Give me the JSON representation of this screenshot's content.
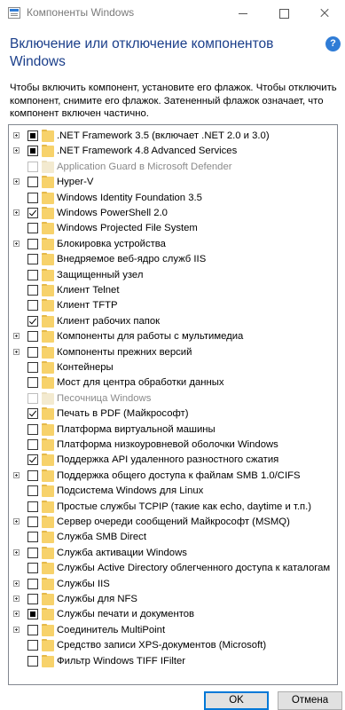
{
  "window": {
    "title": "Компоненты Windows"
  },
  "heading": "Включение или отключение компонентов Windows",
  "description": "Чтобы включить компонент, установите его флажок. Чтобы отключить компонент, снимите его флажок. Затененный флажок означает, что компонент включен частично.",
  "buttons": {
    "ok": "OK",
    "cancel": "Отмена"
  },
  "features": [
    {
      "label": ".NET Framework 3.5 (включает .NET 2.0 и 3.0)",
      "expandable": true,
      "state": "partial",
      "disabled": false
    },
    {
      "label": ".NET Framework 4.8 Advanced Services",
      "expandable": true,
      "state": "partial",
      "disabled": false
    },
    {
      "label": "Application Guard в Microsoft Defender",
      "expandable": false,
      "state": "unchecked",
      "disabled": true
    },
    {
      "label": "Hyper-V",
      "expandable": true,
      "state": "unchecked",
      "disabled": false
    },
    {
      "label": "Windows Identity Foundation 3.5",
      "expandable": false,
      "state": "unchecked",
      "disabled": false
    },
    {
      "label": "Windows PowerShell 2.0",
      "expandable": true,
      "state": "checked",
      "disabled": false
    },
    {
      "label": "Windows Projected File System",
      "expandable": false,
      "state": "unchecked",
      "disabled": false
    },
    {
      "label": "Блокировка устройства",
      "expandable": true,
      "state": "unchecked",
      "disabled": false
    },
    {
      "label": "Внедряемое веб-ядро служб IIS",
      "expandable": false,
      "state": "unchecked",
      "disabled": false
    },
    {
      "label": "Защищенный узел",
      "expandable": false,
      "state": "unchecked",
      "disabled": false
    },
    {
      "label": "Клиент Telnet",
      "expandable": false,
      "state": "unchecked",
      "disabled": false
    },
    {
      "label": "Клиент TFTP",
      "expandable": false,
      "state": "unchecked",
      "disabled": false
    },
    {
      "label": "Клиент рабочих папок",
      "expandable": false,
      "state": "checked",
      "disabled": false
    },
    {
      "label": "Компоненты для работы с мультимедиа",
      "expandable": true,
      "state": "unchecked",
      "disabled": false
    },
    {
      "label": "Компоненты прежних версий",
      "expandable": true,
      "state": "unchecked",
      "disabled": false
    },
    {
      "label": "Контейнеры",
      "expandable": false,
      "state": "unchecked",
      "disabled": false
    },
    {
      "label": "Мост для центра обработки данных",
      "expandable": false,
      "state": "unchecked",
      "disabled": false
    },
    {
      "label": "Песочница Windows",
      "expandable": false,
      "state": "unchecked",
      "disabled": true
    },
    {
      "label": "Печать в PDF (Майкрософт)",
      "expandable": false,
      "state": "checked",
      "disabled": false
    },
    {
      "label": "Платформа виртуальной машины",
      "expandable": false,
      "state": "unchecked",
      "disabled": false
    },
    {
      "label": "Платформа низкоуровневой оболочки Windows",
      "expandable": false,
      "state": "unchecked",
      "disabled": false
    },
    {
      "label": "Поддержка API удаленного разностного сжатия",
      "expandable": false,
      "state": "checked",
      "disabled": false
    },
    {
      "label": "Поддержка общего доступа к файлам SMB 1.0/CIFS",
      "expandable": true,
      "state": "unchecked",
      "disabled": false
    },
    {
      "label": "Подсистема Windows для Linux",
      "expandable": false,
      "state": "unchecked",
      "disabled": false
    },
    {
      "label": "Простые службы TCPIP (такие как echo, daytime и т.п.)",
      "expandable": false,
      "state": "unchecked",
      "disabled": false
    },
    {
      "label": "Сервер очереди сообщений Майкрософт (MSMQ)",
      "expandable": true,
      "state": "unchecked",
      "disabled": false
    },
    {
      "label": "Служба SMB Direct",
      "expandable": false,
      "state": "unchecked",
      "disabled": false
    },
    {
      "label": "Служба активации Windows",
      "expandable": true,
      "state": "unchecked",
      "disabled": false
    },
    {
      "label": "Службы Active Directory облегченного доступа к каталогам",
      "expandable": false,
      "state": "unchecked",
      "disabled": false
    },
    {
      "label": "Службы IIS",
      "expandable": true,
      "state": "unchecked",
      "disabled": false
    },
    {
      "label": "Службы для NFS",
      "expandable": true,
      "state": "unchecked",
      "disabled": false
    },
    {
      "label": "Службы печати и документов",
      "expandable": true,
      "state": "partial",
      "disabled": false
    },
    {
      "label": "Соединитель MultiPoint",
      "expandable": true,
      "state": "unchecked",
      "disabled": false
    },
    {
      "label": "Средство записи XPS-документов (Microsoft)",
      "expandable": false,
      "state": "unchecked",
      "disabled": false
    },
    {
      "label": "Фильтр Windows TIFF IFilter",
      "expandable": false,
      "state": "unchecked",
      "disabled": false
    }
  ]
}
